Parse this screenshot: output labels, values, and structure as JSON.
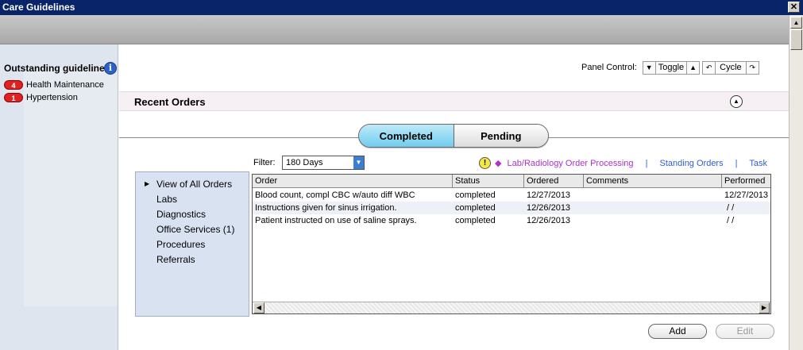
{
  "window": {
    "title": "Care Guidelines",
    "close_glyph": "✕"
  },
  "guidelines": {
    "title": "Outstanding guidelines:",
    "items": [
      {
        "count": "4",
        "label": "Health Maintenance"
      },
      {
        "count": "1",
        "label": "Hypertension"
      }
    ]
  },
  "panel_control": {
    "label": "Panel Control:",
    "toggle": "Toggle",
    "cycle": "Cycle"
  },
  "recent_orders": {
    "title": "Recent Orders"
  },
  "tabs": {
    "completed": "Completed",
    "pending": "Pending"
  },
  "filter": {
    "label": "Filter:",
    "value": "180 Days"
  },
  "links": {
    "lab": "Lab/Radiology Order Processing",
    "standing": "Standing Orders",
    "task": "Task",
    "separator": "|"
  },
  "categories": [
    "View of All Orders",
    "Labs",
    "Diagnostics",
    "Office Services (1)",
    "Procedures",
    "Referrals"
  ],
  "table": {
    "columns": [
      "Order",
      "Status",
      "Ordered",
      "Comments",
      "Performed"
    ],
    "rows": [
      {
        "order": "Blood count, compl CBC w/auto diff WBC",
        "status": "completed",
        "ordered": "12/27/2013",
        "comments": "",
        "performed": "12/27/2013"
      },
      {
        "order": "Instructions given for sinus irrigation.",
        "status": "completed",
        "ordered": "12/26/2013",
        "comments": "",
        "performed": " / /"
      },
      {
        "order": "Patient instructed on use of saline sprays.",
        "status": "completed",
        "ordered": "12/26/2013",
        "comments": "",
        "performed": " / /"
      }
    ]
  },
  "buttons": {
    "add": "Add",
    "edit": "Edit"
  },
  "colors": {
    "titlebar": "#0a246a",
    "active_tab": "#6fcdee",
    "lab_link": "#b02fd0",
    "link": "#2c5fd0",
    "badge": "#d22222"
  }
}
